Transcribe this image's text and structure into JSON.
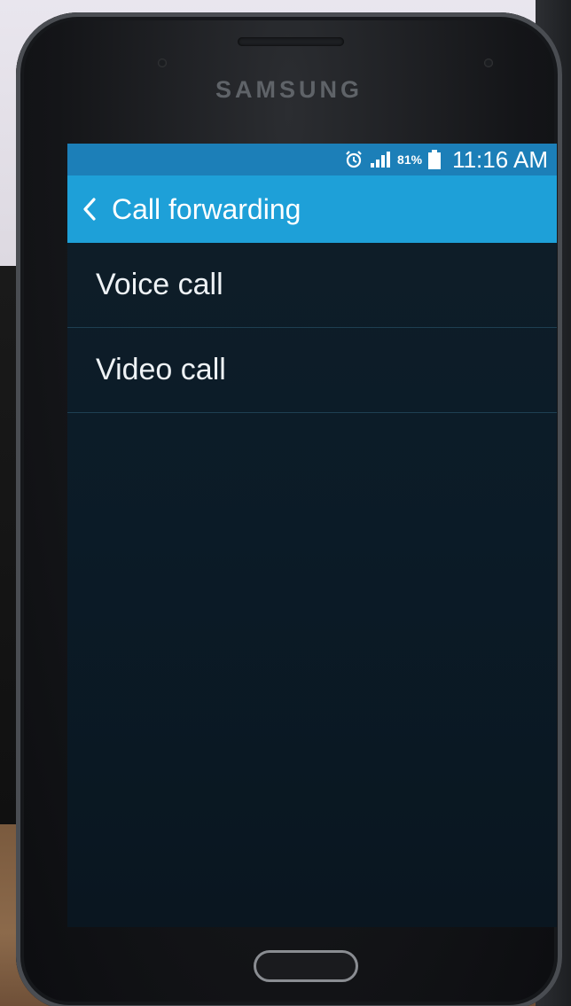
{
  "device": {
    "brand": "SAMSUNG"
  },
  "status_bar": {
    "battery": "81%",
    "time": "11:16 AM",
    "icons": [
      "alarm-icon",
      "signal-icon",
      "battery-icon"
    ]
  },
  "action_bar": {
    "back_icon": "chevron-left-icon",
    "title": "Call forwarding"
  },
  "list": {
    "items": [
      {
        "label": "Voice call"
      },
      {
        "label": "Video call"
      }
    ]
  },
  "colors": {
    "status_bar": "#1c7fb8",
    "action_bar": "#1ea0d8",
    "screen_bg": "#0b1b27",
    "divider": "#1e3f52",
    "text": "#eef2f5"
  }
}
